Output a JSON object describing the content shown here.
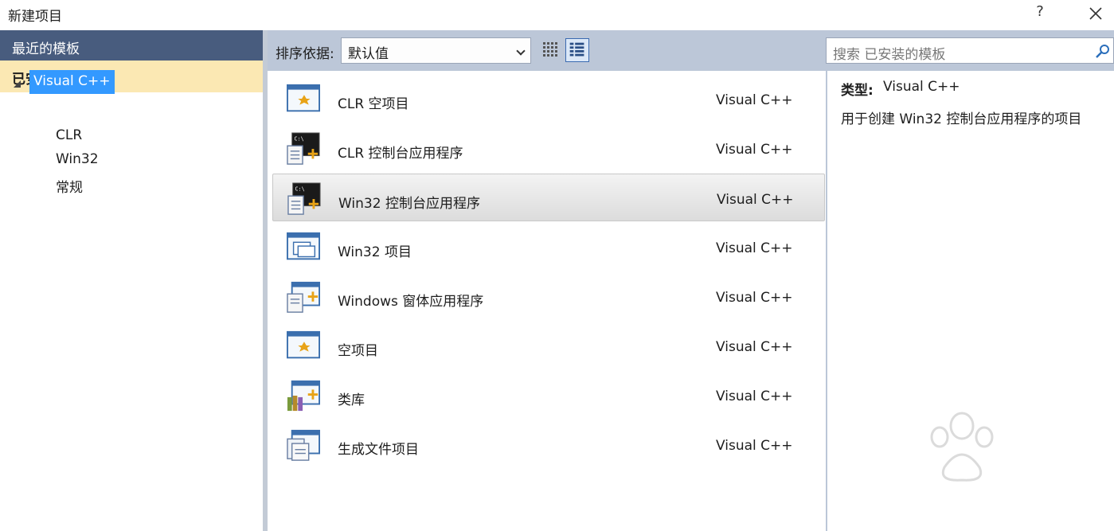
{
  "window": {
    "title": "新建项目",
    "help_label": "?"
  },
  "left_nav": {
    "recent_label": "最近的模板",
    "installed_label": "已安装的模板",
    "tree_root": "Visual C++",
    "tree_children": [
      "CLR",
      "Win32",
      "常规"
    ]
  },
  "toolbar": {
    "sort_label": "排序依据:",
    "sort_value": "默认值"
  },
  "search": {
    "placeholder": "搜索 已安装的模板"
  },
  "templates": [
    {
      "name": "CLR 空项目",
      "lang": "Visual C++",
      "icon": "clr-empty-project-icon"
    },
    {
      "name": "CLR 控制台应用程序",
      "lang": "Visual C++",
      "icon": "console-app-icon"
    },
    {
      "name": "Win32 控制台应用程序",
      "lang": "Visual C++",
      "icon": "console-app-icon",
      "selected": true
    },
    {
      "name": "Win32 项目",
      "lang": "Visual C++",
      "icon": "win32-project-icon"
    },
    {
      "name": "Windows 窗体应用程序",
      "lang": "Visual C++",
      "icon": "windows-forms-icon"
    },
    {
      "name": "空项目",
      "lang": "Visual C++",
      "icon": "empty-project-icon"
    },
    {
      "name": "类库",
      "lang": "Visual C++",
      "icon": "class-library-icon"
    },
    {
      "name": "生成文件项目",
      "lang": "Visual C++",
      "icon": "makefile-project-icon"
    }
  ],
  "details": {
    "type_label": "类型:",
    "type_value": "Visual C++",
    "description": "用于创建 Win32 控制台应用程序的项目"
  },
  "colors": {
    "recent_bg": "#485c7e",
    "installed_bg": "#fbe8b3",
    "tree_selected": "#3399ff",
    "toolbar_bg": "#bcc7d8"
  }
}
